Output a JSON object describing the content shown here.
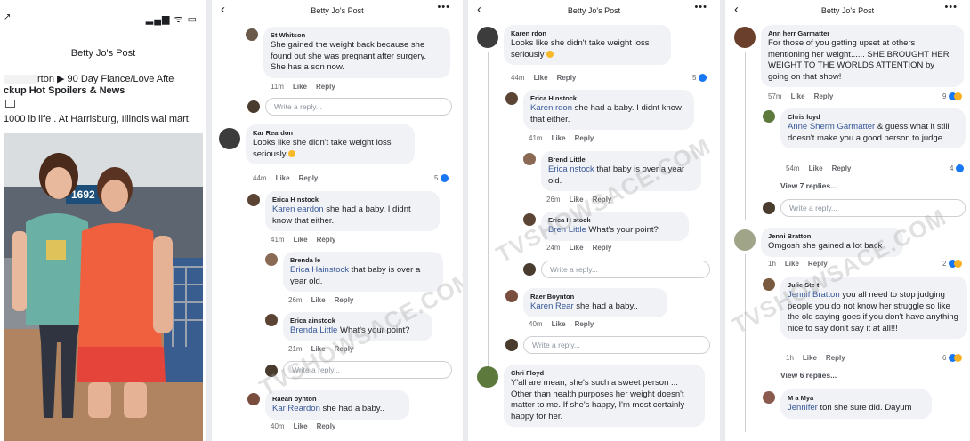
{
  "panel1": {
    "status_location": "↗",
    "status_icons": "▂▄▆ ᯤ ▭",
    "title": "Betty Jo's Post",
    "group_name_suffix": "rton ▶ 90 Day Fiance/Love Afte",
    "group_name_line2": "ckup Hot Spoilers & News",
    "caption": "1000 lb life . At Harrisburg,  Illinois wal mart",
    "store_sign": "1692"
  },
  "header": {
    "title": "Betty Jo's Post",
    "back_icon": "‹",
    "more_icon": "•••"
  },
  "panel2": {
    "c1": {
      "name": "St     Whitson",
      "text": "She gained the weight back because she found out she was pregnant after surgery. She has a son now.",
      "time": "11m",
      "like": "Like",
      "reply": "Reply"
    },
    "reply_placeholder": "Write a reply...",
    "c2": {
      "name": "Kar  Reardon",
      "text": "Looks like she didn't take weight loss seriously",
      "time": "44m",
      "like": "Like",
      "reply": "Reply",
      "count": "5"
    },
    "c3": {
      "name": "Erica H   nstock",
      "mention": "Karen   eardon",
      "text": " she had a baby. I didnt know that either.",
      "time": "41m",
      "like": "Like",
      "reply": "Reply"
    },
    "c4": {
      "name": "Brenda    le",
      "mention": "Erica Hainstock",
      "text": "  that baby is over a year old.",
      "time": "26m",
      "like": "Like",
      "reply": "Reply"
    },
    "c5": {
      "name": "Erica   ainstock",
      "mention": "Brenda Little",
      "text": " What's your point?",
      "time": "21m",
      "like": "Like",
      "reply": "Reply"
    },
    "c6": {
      "name": "Raean     oynton",
      "mention": "Kar     Reardon",
      "text": " she had a baby..",
      "time": "40m",
      "like": "Like",
      "reply": "Reply"
    },
    "watermark": "TVSHOWSACE.COM"
  },
  "panel3": {
    "c1": {
      "name": "Karen     rdon",
      "text": "Looks like she didn't take weight loss seriously",
      "time": "44m",
      "like": "Like",
      "reply": "Reply",
      "count": "5"
    },
    "c2": {
      "name": "Erica H    nstock",
      "mention": "Karen     rdon",
      "text": " she had a baby. I didnt know that either.",
      "time": "41m",
      "like": "Like",
      "reply": "Reply"
    },
    "c3": {
      "name": "Brend    Little",
      "mention": "Erica     nstock",
      "text": "  that baby is over a year old.",
      "time": "26m",
      "like": "Like",
      "reply": "Reply"
    },
    "c4": {
      "name": "Erica H    stock",
      "mention": "Bren     Little",
      "text": " What's your point?",
      "time": "24m",
      "like": "Like",
      "reply": "Reply"
    },
    "reply_placeholder": "Write a reply...",
    "c5": {
      "name": "Raer      Boynton",
      "mention": "Karen Rear   ",
      "text": " she had a baby..",
      "time": "40m",
      "like": "Like",
      "reply": "Reply"
    },
    "c6": {
      "name": "Chri     Floyd",
      "text": "Y'all are mean, she's such a sweet person ... Other than health purposes her weight doesn't matter to me. If she's happy, I'm most certainly happy for her."
    },
    "watermark": "TVSHOWSACE.COM"
  },
  "panel4": {
    "c1": {
      "name": "Ann    herr    Garmatter",
      "text": "For those of you getting upset at others mentioning her weight...... SHE BROUGHT HER WEIGHT TO THE WORLDS ATTENTION by going on that show!",
      "time": "57m",
      "like": "Like",
      "reply": "Reply",
      "count": "9"
    },
    "c2": {
      "name": "Chris      loyd",
      "mention": "Anne Sherm    Garmatter",
      "text": " & guess what it still doesn't make you a good person to judge.",
      "time": "54m",
      "like": "Like",
      "reply": "Reply",
      "count": "4"
    },
    "view1": "View 7 replies...",
    "reply_placeholder": "Write a reply...",
    "c3": {
      "name": "Jenni     Bratton",
      "text": "Omgosh she gained a lot back",
      "time": "1h",
      "like": "Like",
      "reply": "Reply",
      "count": "2"
    },
    "c4": {
      "name": "Julie Ste    t",
      "mention": "Jennif    Bratton",
      "text": " you all need to stop judging people you do not know her struggle so like the old saying goes if you don't have anything nice to say don't say it at all!!!",
      "time": "1h",
      "like": "Like",
      "reply": "Reply",
      "count": "6"
    },
    "view2": "View 6 replies...",
    "c5": {
      "name": "M     a Mya",
      "mention": "Jennifer      ",
      "text": "ton she sure did. Dayum"
    },
    "watermark": "TVSHOWSACE.COM"
  }
}
